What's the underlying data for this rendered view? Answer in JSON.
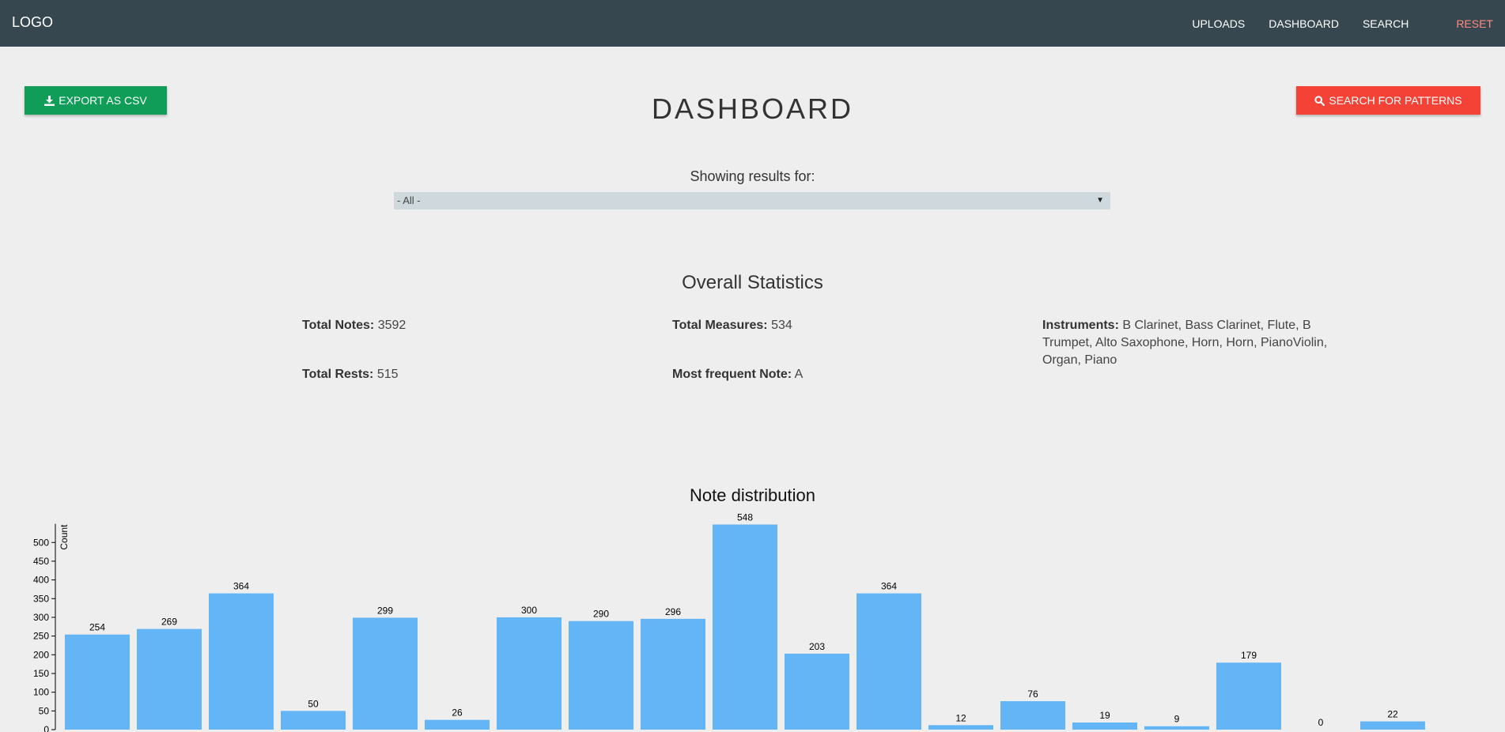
{
  "nav": {
    "logo": "LOGO",
    "links": [
      "UPLOADS",
      "DASHBOARD",
      "SEARCH"
    ],
    "reset": "RESET"
  },
  "toolbar": {
    "export_label": "EXPORT AS CSV",
    "search_patterns_label": "SEARCH FOR PATTERNS"
  },
  "page": {
    "title": "DASHBOARD",
    "showing_label": "Showing results for:",
    "filter_value": "- All -"
  },
  "stats": {
    "title": "Overall Statistics",
    "total_notes_label": "Total Notes:",
    "total_notes": "3592",
    "total_measures_label": "Total Measures:",
    "total_measures": "534",
    "instruments_label": "Instruments:",
    "instruments": "B  Clarinet, Bass Clarinet, Flute, B Trumpet, Alto Saxophone, Horn, Horn, PianoViolin, Organ, Piano",
    "total_rests_label": "Total Rests:",
    "total_rests": "515",
    "most_frequent_label": "Most frequent Note:",
    "most_frequent": "A"
  },
  "colors": {
    "navbar": "#37474f",
    "export_button": "#0f9d58",
    "search_button": "#f44336",
    "reset_link": "#ff8a80",
    "bar": "#64b5f6"
  },
  "chart_data": {
    "type": "bar",
    "title": "Note distribution",
    "ylabel": "Count",
    "ylim": [
      0,
      550
    ],
    "yticks": [
      0,
      50,
      100,
      150,
      200,
      250,
      300,
      350,
      400,
      450,
      500
    ],
    "values": [
      254,
      269,
      364,
      50,
      299,
      26,
      300,
      290,
      296,
      548,
      203,
      364,
      12,
      76,
      19,
      9,
      179,
      0,
      22
    ],
    "grid": false
  }
}
